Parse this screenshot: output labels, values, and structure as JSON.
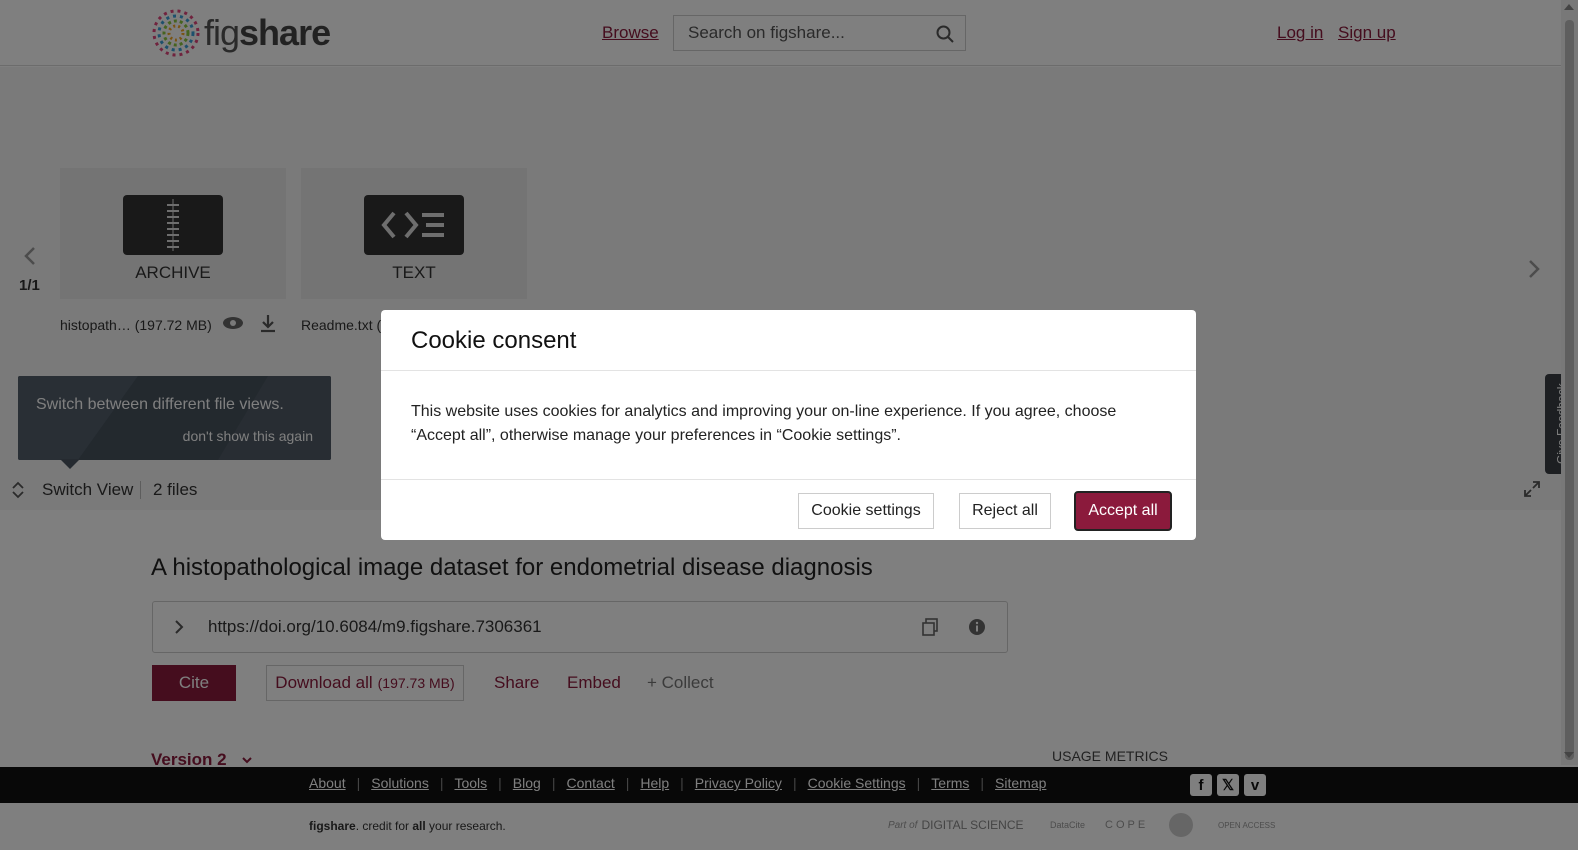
{
  "header": {
    "logo_text_light": "fig",
    "logo_text_bold": "share",
    "browse_label": "Browse",
    "search_placeholder": "Search on figshare...",
    "login_label": "Log in",
    "signup_label": "Sign up"
  },
  "viewer": {
    "pager": "1/1",
    "files": [
      {
        "type_label": "ARCHIVE",
        "name": "histopath…",
        "size": "(197.72 MB)"
      },
      {
        "type_label": "TEXT",
        "name": "Readme.txt ("
      }
    ],
    "tooltip_text": "Switch between different file views.",
    "tooltip_dismiss": "don't show this again",
    "switch_view_label": "Switch View",
    "files_count": "2 files",
    "feedback_label": "Give Feedback"
  },
  "article": {
    "title": "A histopathological image dataset for endometrial disease diagnosis",
    "doi": "https://doi.org/10.6084/m9.figshare.7306361",
    "cite_label": "Cite",
    "download_label": "Download all",
    "download_size": "(197.73 MB)",
    "share_label": "Share",
    "embed_label": "Embed",
    "collect_label": "+ Collect",
    "version_label": "Version 2",
    "usage_metrics_label": "USAGE METRICS"
  },
  "footer": {
    "links": [
      "About",
      "Solutions",
      "Tools",
      "Blog",
      "Contact",
      "Help",
      "Privacy Policy",
      "Cookie Settings",
      "Terms",
      "Sitemap"
    ],
    "tagline_brand": "figshare",
    "tagline_mid": ". credit for ",
    "tagline_all": "all",
    "tagline_end": " your research.",
    "partners": {
      "digital_science_prefix": "Part of",
      "digital_science": "DIGITAL SCIENCE",
      "datacite": "DataCite",
      "cope": "COPE",
      "open_access": "OPEN ACCESS"
    }
  },
  "cookie_modal": {
    "title": "Cookie consent",
    "body": "This website uses cookies for analytics and improving your on-line experience. If you agree, choose “Accept all”, otherwise manage your preferences in “Cookie settings”.",
    "settings_label": "Cookie settings",
    "reject_label": "Reject all",
    "accept_label": "Accept all"
  },
  "colors": {
    "brand": "#8b1a3c",
    "overlay": "rgba(0,0,0,0.5)",
    "footer_bg": "#111111"
  },
  "icons": [
    "search-icon",
    "eye-icon",
    "download-icon",
    "chevron-left-icon",
    "chevron-right-icon",
    "switch-view-icon",
    "expand-icon",
    "copy-icon",
    "info-icon",
    "chevron-down-icon",
    "facebook-icon",
    "x-icon",
    "vimeo-icon"
  ]
}
